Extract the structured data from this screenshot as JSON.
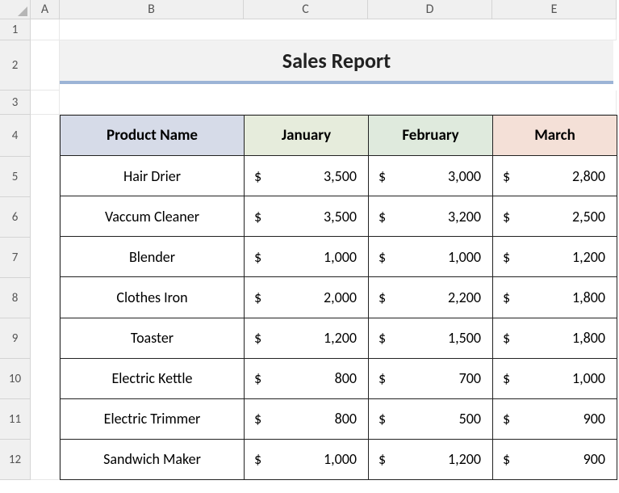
{
  "columns": [
    "A",
    "B",
    "C",
    "D",
    "E"
  ],
  "rows": [
    "1",
    "2",
    "3",
    "4",
    "5",
    "6",
    "7",
    "8",
    "9",
    "10",
    "11",
    "12"
  ],
  "title": "Sales Report",
  "headers": {
    "name": "Product Name",
    "jan": "January",
    "feb": "February",
    "mar": "March"
  },
  "currency": "$",
  "products": [
    {
      "name": "Hair Drier",
      "jan": "3,500",
      "feb": "3,000",
      "mar": "2,800"
    },
    {
      "name": "Vaccum Cleaner",
      "jan": "3,500",
      "feb": "3,200",
      "mar": "2,500"
    },
    {
      "name": "Blender",
      "jan": "1,000",
      "feb": "1,000",
      "mar": "1,200"
    },
    {
      "name": "Clothes Iron",
      "jan": "2,000",
      "feb": "2,200",
      "mar": "1,800"
    },
    {
      "name": "Toaster",
      "jan": "1,200",
      "feb": "1,500",
      "mar": "1,800"
    },
    {
      "name": "Electric Kettle",
      "jan": "800",
      "feb": "700",
      "mar": "1,000"
    },
    {
      "name": "Electric Trimmer",
      "jan": "800",
      "feb": "500",
      "mar": "900"
    },
    {
      "name": "Sandwich Maker",
      "jan": "1,000",
      "feb": "1,200",
      "mar": "900"
    }
  ],
  "chart_data": {
    "type": "table",
    "title": "Sales Report",
    "columns": [
      "Product Name",
      "January",
      "February",
      "March"
    ],
    "rows": [
      [
        "Hair Drier",
        3500,
        3000,
        2800
      ],
      [
        "Vaccum Cleaner",
        3500,
        3200,
        2500
      ],
      [
        "Blender",
        1000,
        1000,
        1200
      ],
      [
        "Clothes Iron",
        2000,
        2200,
        1800
      ],
      [
        "Toaster",
        1200,
        1500,
        1800
      ],
      [
        "Electric Kettle",
        800,
        700,
        1000
      ],
      [
        "Electric Trimmer",
        800,
        500,
        900
      ],
      [
        "Sandwich Maker",
        1000,
        1200,
        900
      ]
    ],
    "currency": "USD"
  }
}
